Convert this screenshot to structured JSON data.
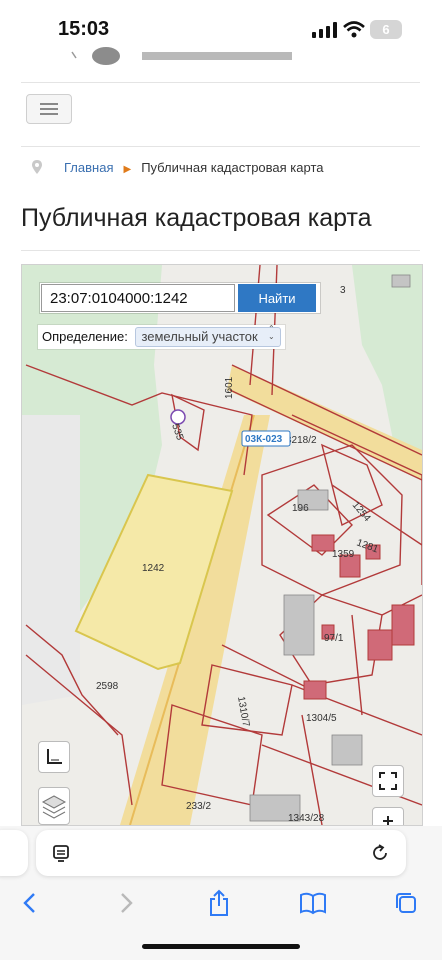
{
  "status_bar": {
    "time": "15:03",
    "battery": "6"
  },
  "breadcrumb": {
    "home": "Главная",
    "current": "Публичная кадастровая карта"
  },
  "page_title": "Публичная кадастровая карта",
  "map": {
    "search_value": "23:07:0104000:1242",
    "search_button": "Найти",
    "definition_label": "Определение:",
    "definition_value": "земельный участок",
    "labels": {
      "lot_1242": "1242",
      "lot_2598": "2598",
      "lot_3": "3",
      "lot_1601": "1601",
      "lot_535": "535",
      "road_03k023": "03К-023",
      "lot_3218_2": "3218/2",
      "lot_196": "196",
      "lot_1254": "1254",
      "lot_1281": "1281",
      "lot_1359": "1359",
      "lot_97_1": "97/1",
      "lot_1310_7": "1310/7",
      "lot_1304_5": "1304/5",
      "lot_233_2": "233/2",
      "lot_1343_28": "1343/28"
    },
    "colors": {
      "selected_fill": "#f5e9a8",
      "parcel_border": "#b23a3a",
      "road": "#f3dfa0",
      "green": "#d2ebd0"
    }
  },
  "browser": {
    "icons": [
      "tab-icon",
      "reload-icon",
      "back-icon",
      "forward-icon",
      "share-icon",
      "bookmarks-icon",
      "tabs-icon"
    ]
  }
}
